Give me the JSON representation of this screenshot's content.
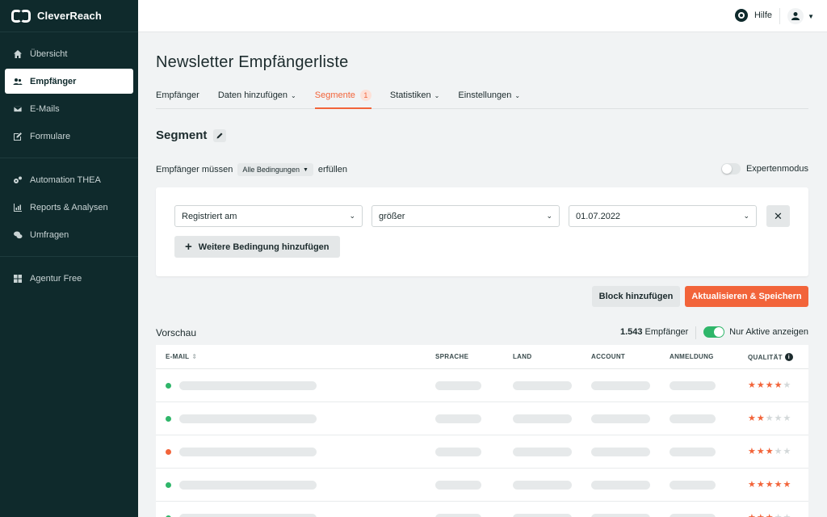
{
  "app": {
    "logo_text": "CleverReach"
  },
  "sidebar": {
    "items": [
      {
        "label": "Übersicht",
        "icon": "home-icon"
      },
      {
        "label": "Empfänger",
        "icon": "users-icon",
        "active": true
      },
      {
        "label": "E-Mails",
        "icon": "mail-icon"
      },
      {
        "label": "Formulare",
        "icon": "form-icon"
      },
      {
        "label": "Automation THEA",
        "icon": "automation-icon"
      },
      {
        "label": "Reports & Analysen",
        "icon": "chart-icon"
      },
      {
        "label": "Umfragen",
        "icon": "chat-icon"
      },
      {
        "label": "Agentur Free",
        "icon": "grid-icon"
      }
    ]
  },
  "topbar": {
    "help_label": "Hilfe"
  },
  "page": {
    "title": "Newsletter Empfängerliste"
  },
  "tabs": [
    {
      "label": "Empfänger",
      "has_dropdown": false
    },
    {
      "label": "Daten hinzufügen",
      "has_dropdown": true
    },
    {
      "label": "Segmente",
      "badge": "1",
      "active": true
    },
    {
      "label": "Statistiken",
      "has_dropdown": true
    },
    {
      "label": "Einstellungen",
      "has_dropdown": true
    }
  ],
  "segment": {
    "title": "Segment",
    "condition_prefix": "Empfänger müssen",
    "condition_mode": "Alle Bedingungen",
    "condition_suffix": "erfüllen",
    "expert_mode_label": "Expertenmodus",
    "expert_mode_on": false,
    "condition": {
      "field": "Registriert am",
      "operator": "größer",
      "value": "01.07.2022"
    },
    "add_condition_label": "Weitere Bedingung hinzufügen",
    "add_block_label": "Block hinzufügen",
    "save_label": "Aktualisieren & Speichern"
  },
  "preview": {
    "title": "Vorschau",
    "count": "1.543",
    "count_suffix": "Empfänger",
    "active_only_label": "Nur Aktive anzeigen",
    "active_only_on": true,
    "columns": [
      "E-MAIL",
      "SPRACHE",
      "LAND",
      "ACCOUNT",
      "ANMELDUNG",
      "QUALITÄT"
    ],
    "rows": [
      {
        "status_color": "#2fb66a",
        "quality": 4
      },
      {
        "status_color": "#2fb66a",
        "quality": 2
      },
      {
        "status_color": "#f2643a",
        "quality": 3
      },
      {
        "status_color": "#2fb66a",
        "quality": 5
      },
      {
        "status_color": "#2fb66a",
        "quality": 3
      }
    ]
  },
  "colors": {
    "accent": "#f2643a",
    "sidebar_bg": "#0f2a2c",
    "success": "#2fb66a"
  }
}
